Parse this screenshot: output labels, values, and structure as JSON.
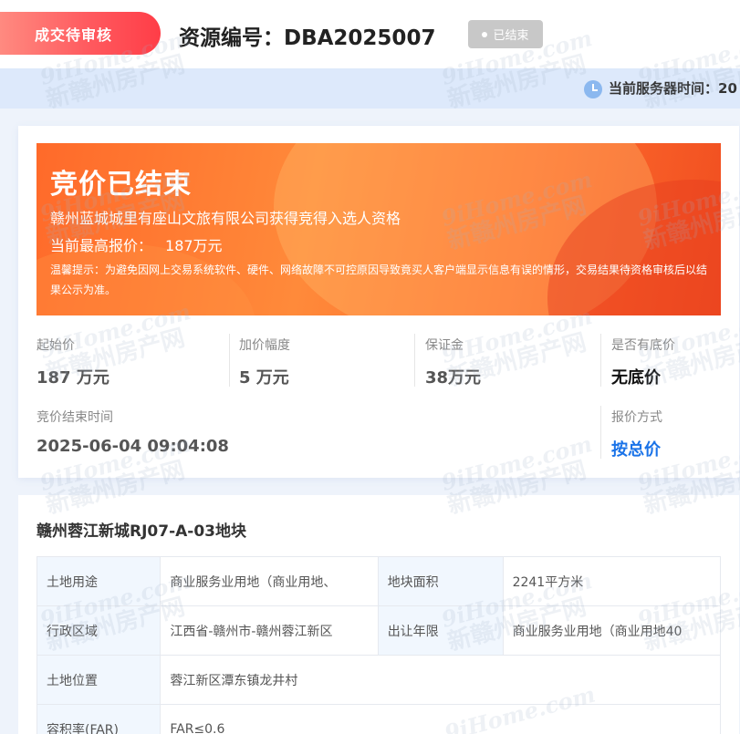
{
  "header": {
    "status_ribbon": "成交待审核",
    "resource_no": "资源编号：DBA2025007",
    "ended_badge": "已结束"
  },
  "time_bar": {
    "label": "当前服务器时间：20"
  },
  "banner": {
    "title": "竞价已结束",
    "winner": "赣州蓝城城里有座山文旅有限公司获得竞得入选人资格",
    "price_label": "当前最高报价：",
    "price_value": "187万元",
    "note": "温馨提示：为避免因网上交易系统软件、硬件、网络故障不可控原因导致竟买人客户端显示信息有误的情形，交易结果待资格审核后以结果公示为准。"
  },
  "auction_info": {
    "starting_price": {
      "label": "起始价",
      "value": "187 万元"
    },
    "increment": {
      "label": "加价幅度",
      "value": "5 万元"
    },
    "deposit": {
      "label": "保证金",
      "value": "38万元"
    },
    "reserve": {
      "label": "是否有底价",
      "value": "无底价"
    },
    "end_time": {
      "label": "竞价结束时间",
      "value": "2025-06-04 09:04:08"
    },
    "bid_method": {
      "label": "报价方式",
      "value": "按总价"
    }
  },
  "plot": {
    "title": "赣州蓉江新城RJ07-A-03地块",
    "rows": [
      {
        "k1": "土地用途",
        "v1": "商业服务业用地（商业用地、",
        "k2": "地块面积",
        "v2": "2241平方米"
      },
      {
        "k1": "行政区域",
        "v1": "江西省-赣州市-赣州蓉江新区",
        "k2": "出让年限",
        "v2": "商业服务业用地（商业用地40"
      },
      {
        "k1": "土地位置",
        "v1": "蓉江新区潭东镇龙井村"
      },
      {
        "k1": "容积率(FAR)",
        "v1": "FAR≤0.6"
      }
    ]
  },
  "watermark": {
    "en": "9iHome.com",
    "cn": "新赣州房产网"
  },
  "colors": {
    "accent_red": "#ff4f55",
    "banner_orange": "#ff7a30",
    "link_blue": "#1a73e8",
    "time_bar_bg": "#dde9fb"
  }
}
